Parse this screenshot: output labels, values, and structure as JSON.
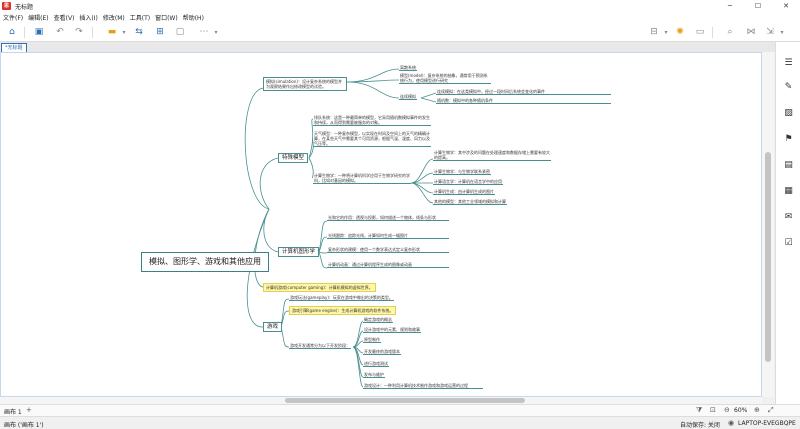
{
  "window": {
    "app_logo": "思",
    "title": "无标题"
  },
  "menu": [
    "文件(F)",
    "编辑(E)",
    "查看(V)",
    "插入(I)",
    "修改(M)",
    "工具(T)",
    "窗口(W)",
    "帮助(H)"
  ],
  "tab": {
    "label": "*无标题"
  },
  "mindmap": {
    "central": "模拟、图形学、游戏和其他应用",
    "branches": [
      {
        "label": "模拟(simulation)：设计复杂系统的模型并为观察结果作出修改模型的试验。",
        "children": [
          {
            "label": "离散系统"
          },
          {
            "label": "模型(model)：复杂系统的抽象，通常用于预测系统行为，使用模型进行研究"
          },
          {
            "label": "连续模拟"
          },
          {
            "label": "连续模拟：在这类模拟中，经过一段时间后系统会变化的事件"
          },
          {
            "label": "随机数：模拟中的各种随机条件"
          }
        ]
      },
      {
        "label": "特殊模型",
        "children": [
          {
            "label": "排队系统：这是一种最简单的模型，它采用随机数模拟事件的发生和持续，从而得到需要被服务的对象。"
          },
          {
            "label": "天气模型：一种复杂模型，以实现在时间及空间上的天气的精确计算，在某些天气中需要其个可用资源，根据气温、湿度、风力以及气压等。"
          },
          {
            "label": "计算生物学：一种将计算机科学应用于生物学研究的学科，比如对基因的模拟。"
          },
          {
            "label": "计算生物学：其中涉及的问题在处理速度和数据存储上需要有较大的提高。"
          },
          {
            "label": "计算生物学：与生物学联系紧密"
          },
          {
            "label": "计算语言学：计算机在语言学中的应用"
          },
          {
            "label": "计算机生成：由计算机生成的图片"
          },
          {
            "label": "其他的模型：其他工业领域的模拟和计算"
          }
        ]
      },
      {
        "label": "计算机图形学",
        "children": [
          {
            "label": "光和它的作用：透视与投影，如何描述一个物体，线条与形状"
          },
          {
            "label": "光线跟踪：追踪光线，计算如何生成一幅图片"
          },
          {
            "label": "复杂形状的建模：使用一个数学表达式定义复杂形状"
          },
          {
            "label": "计算机动画：通过计算机程序生成的图像或动画"
          }
        ]
      },
      {
        "label": "计算机游戏(computer gaming)：计算机模拟的虚拟世界。"
      },
      {
        "label": "游戏",
        "children": [
          {
            "label": "游戏玩法(gameplay)：玩家在游戏中做出的决策的类型。"
          },
          {
            "label": "游戏引擎(game engine)：生成计算机游戏的软件系统。"
          },
          {
            "label": "游戏开发通常分为以下开发阶段："
          },
          {
            "label": "确定游戏的概念"
          },
          {
            "label": "设计游戏中的元素、规则和故事"
          },
          {
            "label": "原型制作"
          },
          {
            "label": "开发最终的游戏版本"
          },
          {
            "label": "进行游戏测试"
          },
          {
            "label": "发布与维护"
          },
          {
            "label": "游戏设计：一种利用计算机技术制作游戏和游戏运营的过程"
          }
        ]
      }
    ]
  },
  "sheet_tab": "画布 1",
  "zoom": "60%",
  "status": {
    "left": "画布 ('画布 1')",
    "autosave": "自动保存: 关闭",
    "computer": "LAPTOP-EVEGBQPE"
  }
}
